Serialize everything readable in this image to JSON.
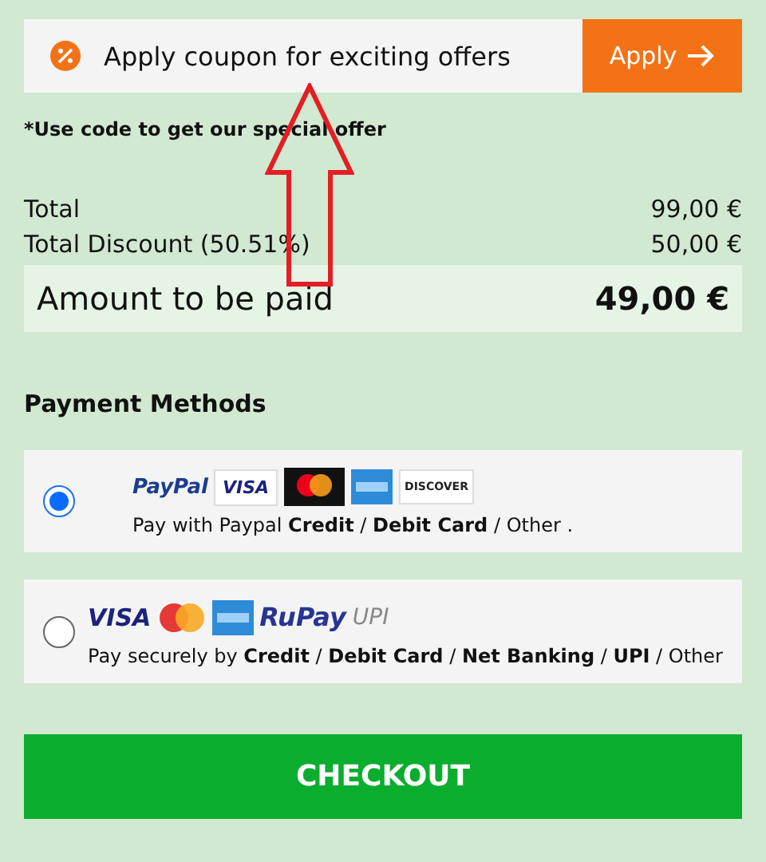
{
  "coupon": {
    "text": "Apply coupon for exciting offers",
    "button": "Apply"
  },
  "note": "*Use code to get our special offer",
  "totals": [
    {
      "label": "Total",
      "value": "99,00 €"
    },
    {
      "label": "Total Discount (50.51%)",
      "value": "50,00 €"
    }
  ],
  "amount": {
    "label": "Amount to be paid",
    "value": "49,00 €"
  },
  "payment_title": "Payment Methods",
  "methods": [
    {
      "selected": true,
      "description": "Pay with Paypal **Credit** / **Debit Card** / Other .",
      "logos": [
        {
          "kind": "paypal",
          "text": "PayPal"
        },
        {
          "kind": "visa-box",
          "text": "VISA"
        },
        {
          "kind": "mastercard"
        },
        {
          "kind": "amex"
        },
        {
          "kind": "discover",
          "text": "DISCOVER"
        }
      ]
    },
    {
      "selected": false,
      "description": "Pay securely by **Credit** / **Debit Card** / **Net Banking** / **UPI** / Other",
      "logos": [
        {
          "kind": "visa",
          "text": "VISA"
        },
        {
          "kind": "mastercard-round"
        },
        {
          "kind": "amex"
        },
        {
          "kind": "rupay",
          "text": "RuPay"
        },
        {
          "kind": "upi",
          "text": "UPI"
        }
      ]
    }
  ],
  "checkout": "CHECKOUT"
}
